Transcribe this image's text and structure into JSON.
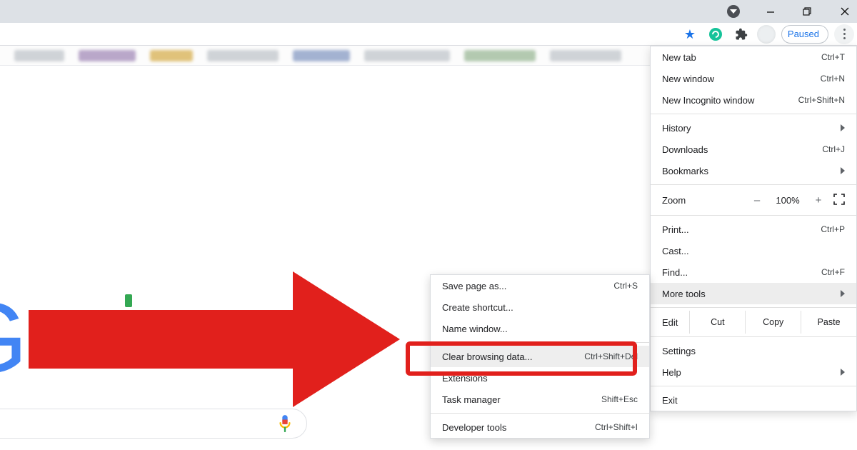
{
  "window": {
    "caret_icon": "dropdown-caret",
    "minimize": "–",
    "maximize": "❐",
    "close": "✕"
  },
  "toolbar": {
    "star_title": "bookmark",
    "extension_grammarly": "Grammarly",
    "extensions_icon": "extensions",
    "paused_label": "Paused",
    "overflow_title": "Customize and control"
  },
  "menu": {
    "new_tab": {
      "label": "New tab",
      "shortcut": "Ctrl+T"
    },
    "new_window": {
      "label": "New window",
      "shortcut": "Ctrl+N"
    },
    "new_incognito": {
      "label": "New Incognito window",
      "shortcut": "Ctrl+Shift+N"
    },
    "history": {
      "label": "History"
    },
    "downloads": {
      "label": "Downloads",
      "shortcut": "Ctrl+J"
    },
    "bookmarks": {
      "label": "Bookmarks"
    },
    "zoom": {
      "label": "Zoom",
      "minus": "–",
      "value": "100%",
      "plus": "+"
    },
    "print": {
      "label": "Print...",
      "shortcut": "Ctrl+P"
    },
    "cast": {
      "label": "Cast..."
    },
    "find": {
      "label": "Find...",
      "shortcut": "Ctrl+F"
    },
    "more_tools": {
      "label": "More tools"
    },
    "edit": {
      "label": "Edit",
      "cut": "Cut",
      "copy": "Copy",
      "paste": "Paste"
    },
    "settings": {
      "label": "Settings"
    },
    "help": {
      "label": "Help"
    },
    "exit": {
      "label": "Exit"
    }
  },
  "submenu": {
    "save_page": {
      "label": "Save page as...",
      "shortcut": "Ctrl+S"
    },
    "create_shortcut": {
      "label": "Create shortcut..."
    },
    "name_window": {
      "label": "Name window..."
    },
    "clear_data": {
      "label": "Clear browsing data...",
      "shortcut": "Ctrl+Shift+Del"
    },
    "extensions": {
      "label": "Extensions"
    },
    "task_manager": {
      "label": "Task manager",
      "shortcut": "Shift+Esc"
    },
    "dev_tools": {
      "label": "Developer tools",
      "shortcut": "Ctrl+Shift+I"
    }
  },
  "page": {
    "logo_letter": "G"
  }
}
